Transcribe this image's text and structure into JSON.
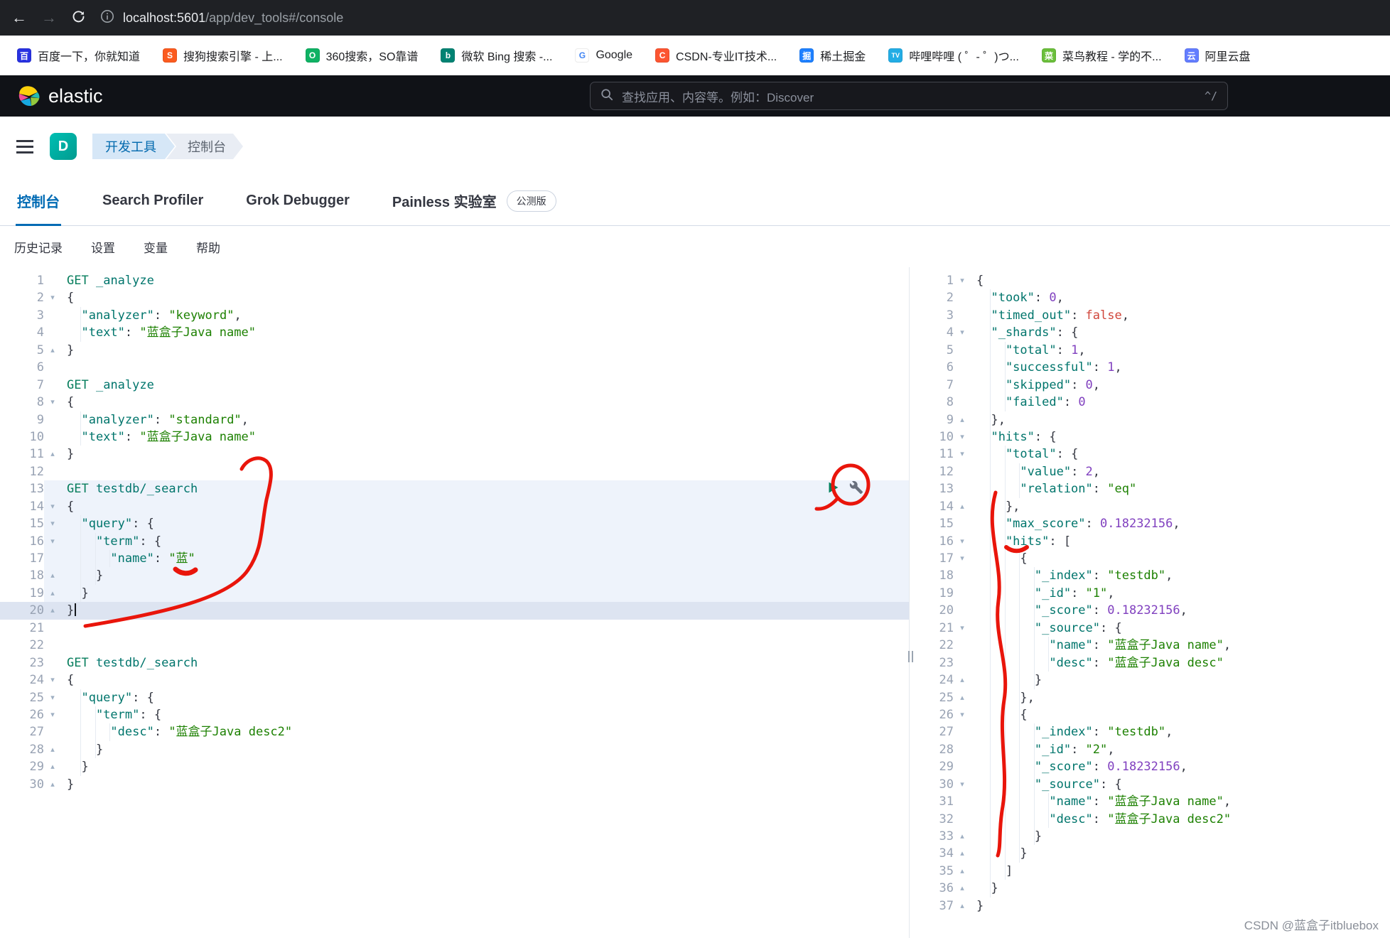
{
  "browser": {
    "url_host": "localhost:5601",
    "url_path": "/app/dev_tools#/console",
    "bookmarks": [
      {
        "label": "百度一下，你就知道",
        "glyph": "百",
        "bg": "#2932E1",
        "fg": "#ffffff"
      },
      {
        "label": "搜狗搜索引擎 - 上...",
        "glyph": "S",
        "bg": "#FB5B1F",
        "fg": "#ffffff"
      },
      {
        "label": "360搜索，SO靠谱",
        "glyph": "O",
        "bg": "#0FB264",
        "fg": "#ffffff"
      },
      {
        "label": "微软 Bing 搜索 -...",
        "glyph": "b",
        "bg": "#008373",
        "fg": "#ffffff"
      },
      {
        "label": "Google",
        "glyph": "G",
        "bg": "#ffffff",
        "fg": "#4285F4"
      },
      {
        "label": "CSDN-专业IT技术...",
        "glyph": "C",
        "bg": "#FC5531",
        "fg": "#ffffff"
      },
      {
        "label": "稀土掘金",
        "glyph": "掘",
        "bg": "#1E80FF",
        "fg": "#ffffff"
      },
      {
        "label": "哔哩哔哩 ( ゜- ゜)つ...",
        "glyph": "TV",
        "bg": "#23ADE5",
        "fg": "#ffffff"
      },
      {
        "label": "菜鸟教程 - 学的不...",
        "glyph": "菜",
        "bg": "#6BBF3B",
        "fg": "#ffffff"
      },
      {
        "label": "阿里云盘",
        "glyph": "云",
        "bg": "#637DFF",
        "fg": "#ffffff"
      }
    ]
  },
  "header": {
    "brand": "elastic",
    "search_placeholder": "查找应用、内容等。例如：Discover",
    "shortcut_hint": "^/"
  },
  "breadcrumbs": {
    "space_initial": "D",
    "items": [
      "开发工具",
      "控制台"
    ]
  },
  "tabs": {
    "items": [
      {
        "label": "控制台",
        "active": true
      },
      {
        "label": "Search Profiler",
        "active": false
      },
      {
        "label": "Grok Debugger",
        "active": false
      },
      {
        "label": "Painless 实验室",
        "active": false,
        "badge": "公测版"
      }
    ]
  },
  "toolbar": {
    "items": [
      "历史记录",
      "设置",
      "变量",
      "帮助"
    ]
  },
  "colors": {
    "accent_blue": "#006bb4",
    "annotation_red": "#e9150b",
    "selection_bg": "#eef3fb",
    "active_line_bg": "#dde4f1",
    "play_green": "#00805c"
  },
  "console": {
    "request_lines": [
      {
        "n": 1,
        "t": [
          [
            "m",
            "GET"
          ],
          [
            "p",
            " "
          ],
          [
            "u",
            "_analyze"
          ]
        ]
      },
      {
        "n": 2,
        "fold": "down",
        "t": [
          [
            "p",
            "{"
          ]
        ]
      },
      {
        "n": 3,
        "t": [
          [
            "i",
            1
          ],
          [
            "k",
            "\"analyzer\""
          ],
          [
            "p",
            ": "
          ],
          [
            "s",
            "\"keyword\""
          ],
          [
            "p",
            ","
          ]
        ]
      },
      {
        "n": 4,
        "t": [
          [
            "i",
            1
          ],
          [
            "k",
            "\"text\""
          ],
          [
            "p",
            ": "
          ],
          [
            "s",
            "\"蓝盒子Java name\""
          ]
        ]
      },
      {
        "n": 5,
        "fold": "up",
        "t": [
          [
            "p",
            "}"
          ]
        ]
      },
      {
        "n": 6,
        "t": []
      },
      {
        "n": 7,
        "t": [
          [
            "m",
            "GET"
          ],
          [
            "p",
            " "
          ],
          [
            "u",
            "_analyze"
          ]
        ]
      },
      {
        "n": 8,
        "fold": "down",
        "t": [
          [
            "p",
            "{"
          ]
        ]
      },
      {
        "n": 9,
        "t": [
          [
            "i",
            1
          ],
          [
            "k",
            "\"analyzer\""
          ],
          [
            "p",
            ": "
          ],
          [
            "s",
            "\"standard\""
          ],
          [
            "p",
            ","
          ]
        ]
      },
      {
        "n": 10,
        "t": [
          [
            "i",
            1
          ],
          [
            "k",
            "\"text\""
          ],
          [
            "p",
            ": "
          ],
          [
            "s",
            "\"蓝盒子Java name\""
          ]
        ]
      },
      {
        "n": 11,
        "fold": "up",
        "t": [
          [
            "p",
            "}"
          ]
        ]
      },
      {
        "n": 12,
        "t": []
      },
      {
        "n": 13,
        "hl": true,
        "t": [
          [
            "m",
            "GET"
          ],
          [
            "p",
            " "
          ],
          [
            "u",
            "testdb/_search"
          ]
        ]
      },
      {
        "n": 14,
        "hl": true,
        "fold": "down",
        "t": [
          [
            "p",
            "{"
          ]
        ]
      },
      {
        "n": 15,
        "hl": true,
        "fold": "down",
        "t": [
          [
            "i",
            1
          ],
          [
            "k",
            "\"query\""
          ],
          [
            "p",
            ": {"
          ]
        ]
      },
      {
        "n": 16,
        "hl": true,
        "fold": "down",
        "t": [
          [
            "i",
            2
          ],
          [
            "k",
            "\"term\""
          ],
          [
            "p",
            ": {"
          ]
        ]
      },
      {
        "n": 17,
        "hl": true,
        "t": [
          [
            "i",
            3
          ],
          [
            "k",
            "\"name\""
          ],
          [
            "p",
            ": "
          ],
          [
            "s",
            "\"蓝\""
          ]
        ]
      },
      {
        "n": 18,
        "hl": true,
        "fold": "up",
        "t": [
          [
            "i",
            2
          ],
          [
            "p",
            "}"
          ]
        ]
      },
      {
        "n": 19,
        "hl": true,
        "fold": "up",
        "t": [
          [
            "i",
            1
          ],
          [
            "p",
            "}"
          ]
        ]
      },
      {
        "n": 20,
        "hl2": true,
        "fold": "up",
        "caret": true,
        "t": [
          [
            "p",
            "}"
          ]
        ]
      },
      {
        "n": 21,
        "t": []
      },
      {
        "n": 22,
        "t": []
      },
      {
        "n": 23,
        "t": [
          [
            "m",
            "GET"
          ],
          [
            "p",
            " "
          ],
          [
            "u",
            "testdb/_search"
          ]
        ]
      },
      {
        "n": 24,
        "fold": "down",
        "t": [
          [
            "p",
            "{"
          ]
        ]
      },
      {
        "n": 25,
        "fold": "down",
        "t": [
          [
            "i",
            1
          ],
          [
            "k",
            "\"query\""
          ],
          [
            "p",
            ": {"
          ]
        ]
      },
      {
        "n": 26,
        "fold": "down",
        "t": [
          [
            "i",
            2
          ],
          [
            "k",
            "\"term\""
          ],
          [
            "p",
            ": {"
          ]
        ]
      },
      {
        "n": 27,
        "t": [
          [
            "i",
            3
          ],
          [
            "k",
            "\"desc\""
          ],
          [
            "p",
            ": "
          ],
          [
            "s",
            "\"蓝盒子Java desc2\""
          ]
        ]
      },
      {
        "n": 28,
        "fold": "up",
        "t": [
          [
            "i",
            2
          ],
          [
            "p",
            "}"
          ]
        ]
      },
      {
        "n": 29,
        "fold": "up",
        "t": [
          [
            "i",
            1
          ],
          [
            "p",
            "}"
          ]
        ]
      },
      {
        "n": 30,
        "fold": "up",
        "t": [
          [
            "p",
            "}"
          ]
        ]
      }
    ],
    "response_lines": [
      {
        "n": 1,
        "fold": "down",
        "t": [
          [
            "p",
            "{"
          ]
        ]
      },
      {
        "n": 2,
        "t": [
          [
            "i",
            1
          ],
          [
            "k",
            "\"took\""
          ],
          [
            "p",
            ": "
          ],
          [
            "n",
            "0"
          ],
          [
            "p",
            ","
          ]
        ]
      },
      {
        "n": 3,
        "t": [
          [
            "i",
            1
          ],
          [
            "k",
            "\"timed_out\""
          ],
          [
            "p",
            ": "
          ],
          [
            "b",
            "false"
          ],
          [
            "p",
            ","
          ]
        ]
      },
      {
        "n": 4,
        "fold": "down",
        "t": [
          [
            "i",
            1
          ],
          [
            "k",
            "\"_shards\""
          ],
          [
            "p",
            ": {"
          ]
        ]
      },
      {
        "n": 5,
        "t": [
          [
            "i",
            2
          ],
          [
            "k",
            "\"total\""
          ],
          [
            "p",
            ": "
          ],
          [
            "n",
            "1"
          ],
          [
            "p",
            ","
          ]
        ]
      },
      {
        "n": 6,
        "t": [
          [
            "i",
            2
          ],
          [
            "k",
            "\"successful\""
          ],
          [
            "p",
            ": "
          ],
          [
            "n",
            "1"
          ],
          [
            "p",
            ","
          ]
        ]
      },
      {
        "n": 7,
        "t": [
          [
            "i",
            2
          ],
          [
            "k",
            "\"skipped\""
          ],
          [
            "p",
            ": "
          ],
          [
            "n",
            "0"
          ],
          [
            "p",
            ","
          ]
        ]
      },
      {
        "n": 8,
        "t": [
          [
            "i",
            2
          ],
          [
            "k",
            "\"failed\""
          ],
          [
            "p",
            ": "
          ],
          [
            "n",
            "0"
          ]
        ]
      },
      {
        "n": 9,
        "fold": "up",
        "t": [
          [
            "i",
            1
          ],
          [
            "p",
            "},"
          ]
        ]
      },
      {
        "n": 10,
        "fold": "down",
        "t": [
          [
            "i",
            1
          ],
          [
            "k",
            "\"hits\""
          ],
          [
            "p",
            ": {"
          ]
        ]
      },
      {
        "n": 11,
        "fold": "down",
        "t": [
          [
            "i",
            2
          ],
          [
            "k",
            "\"total\""
          ],
          [
            "p",
            ": {"
          ]
        ]
      },
      {
        "n": 12,
        "t": [
          [
            "i",
            3
          ],
          [
            "k",
            "\"value\""
          ],
          [
            "p",
            ": "
          ],
          [
            "n",
            "2"
          ],
          [
            "p",
            ","
          ]
        ]
      },
      {
        "n": 13,
        "t": [
          [
            "i",
            3
          ],
          [
            "k",
            "\"relation\""
          ],
          [
            "p",
            ": "
          ],
          [
            "s",
            "\"eq\""
          ]
        ]
      },
      {
        "n": 14,
        "fold": "up",
        "t": [
          [
            "i",
            2
          ],
          [
            "p",
            "},"
          ]
        ]
      },
      {
        "n": 15,
        "t": [
          [
            "i",
            2
          ],
          [
            "k",
            "\"max_score\""
          ],
          [
            "p",
            ": "
          ],
          [
            "n",
            "0.18232156"
          ],
          [
            "p",
            ","
          ]
        ]
      },
      {
        "n": 16,
        "fold": "down",
        "t": [
          [
            "i",
            2
          ],
          [
            "k",
            "\"hits\""
          ],
          [
            "p",
            ": ["
          ]
        ]
      },
      {
        "n": 17,
        "fold": "down",
        "t": [
          [
            "i",
            3
          ],
          [
            "p",
            "{"
          ]
        ]
      },
      {
        "n": 18,
        "t": [
          [
            "i",
            4
          ],
          [
            "k",
            "\"_index\""
          ],
          [
            "p",
            ": "
          ],
          [
            "s",
            "\"testdb\""
          ],
          [
            "p",
            ","
          ]
        ]
      },
      {
        "n": 19,
        "t": [
          [
            "i",
            4
          ],
          [
            "k",
            "\"_id\""
          ],
          [
            "p",
            ": "
          ],
          [
            "s",
            "\"1\""
          ],
          [
            "p",
            ","
          ]
        ]
      },
      {
        "n": 20,
        "t": [
          [
            "i",
            4
          ],
          [
            "k",
            "\"_score\""
          ],
          [
            "p",
            ": "
          ],
          [
            "n",
            "0.18232156"
          ],
          [
            "p",
            ","
          ]
        ]
      },
      {
        "n": 21,
        "fold": "down",
        "t": [
          [
            "i",
            4
          ],
          [
            "k",
            "\"_source\""
          ],
          [
            "p",
            ": {"
          ]
        ]
      },
      {
        "n": 22,
        "t": [
          [
            "i",
            5
          ],
          [
            "k",
            "\"name\""
          ],
          [
            "p",
            ": "
          ],
          [
            "s",
            "\"蓝盒子Java name\""
          ],
          [
            "p",
            ","
          ]
        ]
      },
      {
        "n": 23,
        "t": [
          [
            "i",
            5
          ],
          [
            "k",
            "\"desc\""
          ],
          [
            "p",
            ": "
          ],
          [
            "s",
            "\"蓝盒子Java desc\""
          ]
        ]
      },
      {
        "n": 24,
        "fold": "up",
        "t": [
          [
            "i",
            4
          ],
          [
            "p",
            "}"
          ]
        ]
      },
      {
        "n": 25,
        "fold": "up",
        "t": [
          [
            "i",
            3
          ],
          [
            "p",
            "},"
          ]
        ]
      },
      {
        "n": 26,
        "fold": "down",
        "t": [
          [
            "i",
            3
          ],
          [
            "p",
            "{"
          ]
        ]
      },
      {
        "n": 27,
        "t": [
          [
            "i",
            4
          ],
          [
            "k",
            "\"_index\""
          ],
          [
            "p",
            ": "
          ],
          [
            "s",
            "\"testdb\""
          ],
          [
            "p",
            ","
          ]
        ]
      },
      {
        "n": 28,
        "t": [
          [
            "i",
            4
          ],
          [
            "k",
            "\"_id\""
          ],
          [
            "p",
            ": "
          ],
          [
            "s",
            "\"2\""
          ],
          [
            "p",
            ","
          ]
        ]
      },
      {
        "n": 29,
        "t": [
          [
            "i",
            4
          ],
          [
            "k",
            "\"_score\""
          ],
          [
            "p",
            ": "
          ],
          [
            "n",
            "0.18232156"
          ],
          [
            "p",
            ","
          ]
        ]
      },
      {
        "n": 30,
        "fold": "down",
        "t": [
          [
            "i",
            4
          ],
          [
            "k",
            "\"_source\""
          ],
          [
            "p",
            ": {"
          ]
        ]
      },
      {
        "n": 31,
        "t": [
          [
            "i",
            5
          ],
          [
            "k",
            "\"name\""
          ],
          [
            "p",
            ": "
          ],
          [
            "s",
            "\"蓝盒子Java name\""
          ],
          [
            "p",
            ","
          ]
        ]
      },
      {
        "n": 32,
        "t": [
          [
            "i",
            5
          ],
          [
            "k",
            "\"desc\""
          ],
          [
            "p",
            ": "
          ],
          [
            "s",
            "\"蓝盒子Java desc2\""
          ]
        ]
      },
      {
        "n": 33,
        "fold": "up",
        "t": [
          [
            "i",
            4
          ],
          [
            "p",
            "}"
          ]
        ]
      },
      {
        "n": 34,
        "fold": "up",
        "t": [
          [
            "i",
            3
          ],
          [
            "p",
            "}"
          ]
        ]
      },
      {
        "n": 35,
        "fold": "up",
        "t": [
          [
            "i",
            2
          ],
          [
            "p",
            "]"
          ]
        ]
      },
      {
        "n": 36,
        "fold": "up",
        "t": [
          [
            "i",
            1
          ],
          [
            "p",
            "}"
          ]
        ]
      },
      {
        "n": 37,
        "fold": "up",
        "t": [
          [
            "p",
            "}"
          ]
        ]
      }
    ]
  },
  "watermark": "CSDN @蓝盒子itbluebox"
}
